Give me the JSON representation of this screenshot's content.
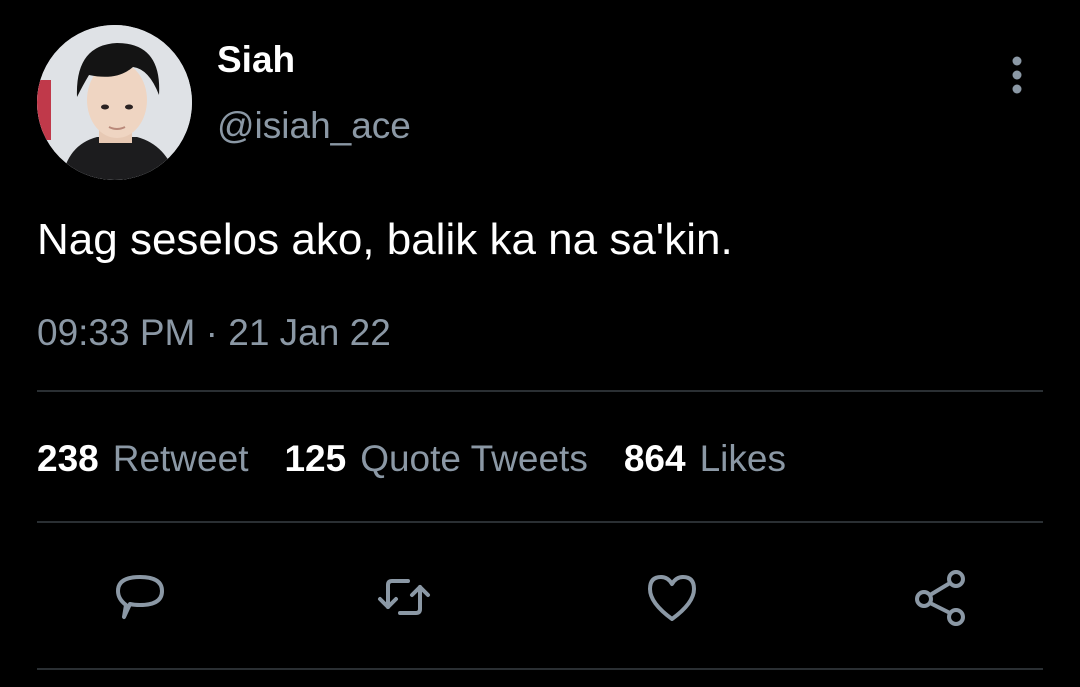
{
  "author": {
    "display_name": "Siah",
    "handle": "@isiah_ace"
  },
  "tweet": {
    "text": "Nag seselos ako, balik ka na sa'kin.",
    "timestamp": "09:33 PM · 21 Jan 22"
  },
  "stats": [
    {
      "count": "238",
      "label": "Retweet"
    },
    {
      "count": "125",
      "label": "Quote Tweets"
    },
    {
      "count": "864",
      "label": "Likes"
    }
  ],
  "actions": [
    "reply-icon",
    "retweet-icon",
    "like-icon",
    "share-icon"
  ],
  "colors": {
    "background": "#000000",
    "primary_text": "#ffffff",
    "secondary_text": "#8b98a5",
    "divider": "#2a2f33"
  }
}
